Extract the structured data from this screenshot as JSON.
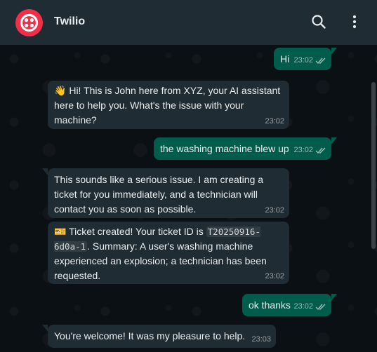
{
  "header": {
    "title": "Twilio",
    "avatar_icon": "twilio-logo",
    "search_icon": "search-icon",
    "menu_icon": "kebab-menu-icon",
    "brand_color": "#f22f46"
  },
  "messages": [
    {
      "direction": "outgoing",
      "text": "Hi",
      "time": "23:02",
      "status": "read"
    },
    {
      "direction": "incoming",
      "emoji": "👋",
      "text": "Hi! This is John here from XYZ, your AI assistant here to help you. What's the issue with your machine?",
      "time": "23:02"
    },
    {
      "direction": "outgoing",
      "text": "the washing machine blew up",
      "time": "23:02",
      "status": "read"
    },
    {
      "direction": "incoming",
      "text": "This sounds like a serious issue. I am creating a ticket for you immediately, and a technician will contact you as soon as possible.",
      "time": "23:02"
    },
    {
      "direction": "incoming",
      "emoji": "🎫",
      "text_before": "Ticket created! Your ticket ID is",
      "ticket_id": "T20250916-6d0a-1",
      "text_after": ". Summary: A user's washing machine experienced an explosion; a technician has been requested.",
      "time": "23:02"
    },
    {
      "direction": "outgoing",
      "text": "ok thanks",
      "time": "23:02",
      "status": "read"
    },
    {
      "direction": "incoming",
      "text": "You're welcome! It was my pleasure to help.",
      "time": "23:03"
    }
  ],
  "colors": {
    "header_bg": "#202c33",
    "chat_bg": "#0b1014",
    "incoming_bg": "#202c33",
    "outgoing_bg": "#005c4b",
    "tick_read": "#53bdeb"
  }
}
